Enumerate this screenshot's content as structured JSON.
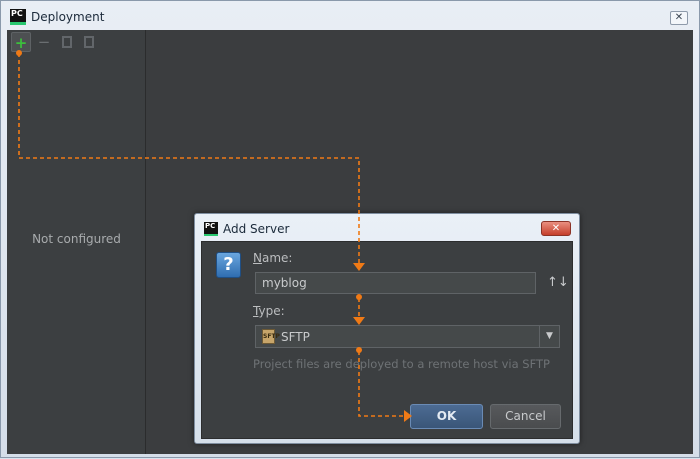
{
  "window": {
    "title": "Deployment",
    "app_icon_text": "PC",
    "close_glyph": "✕"
  },
  "toolbar": {
    "add_glyph": "+",
    "remove_glyph": "−",
    "icons": [
      "plus-icon",
      "minus-icon",
      "copy-icon",
      "paste-icon"
    ]
  },
  "left_pane": {
    "empty_text": "Not configured"
  },
  "dialog": {
    "title": "Add Server",
    "app_icon_text": "PC",
    "close_glyph": "✕",
    "help_glyph": "?",
    "name_label_mnemonic": "N",
    "name_label_rest": "ame:",
    "name_value": "myblog",
    "sort_glyph": "↑↓",
    "type_label_mnemonic": "T",
    "type_label_rest": "ype:",
    "type_value": "SFTP",
    "type_icon_text": "SFTP",
    "dropdown_glyph": "▼",
    "hint": "Project files are deployed to a remote host via SFTP",
    "ok_label": "OK",
    "cancel_label": "Cancel"
  },
  "colors": {
    "annotation": "#f07a16",
    "panel_bg": "#3c3f41",
    "add_green": "#3cbf3c",
    "ok_blue": "#3a5678"
  }
}
